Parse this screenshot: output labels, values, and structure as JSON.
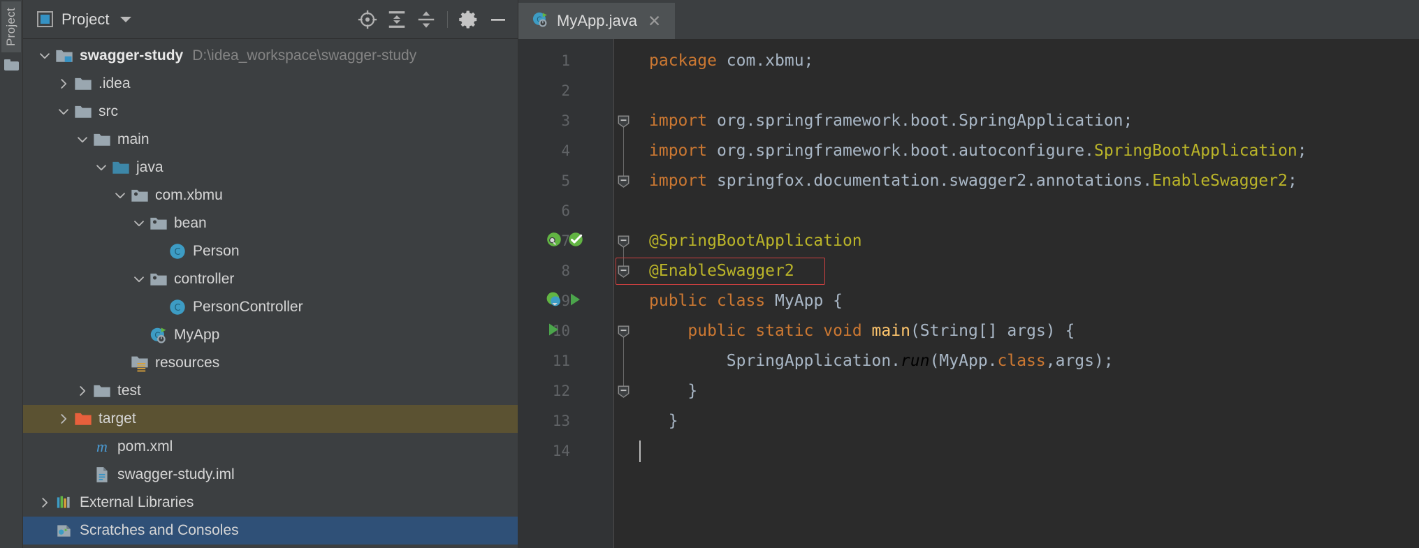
{
  "theme": {
    "panel_bg": "#3c3f41",
    "editor_bg": "#2b2b2b",
    "gutter_bg": "#313335",
    "tab_active_bg": "#4e5254",
    "tab_underline": "#4a88c7",
    "selection_active": "#2f5077",
    "selection_inactive": "#5b5232",
    "accent_blue": "#3592c4",
    "annotation_yellow": "#bbb529",
    "keyword_orange": "#cc7832",
    "text_default": "#a9b7c6",
    "highlight_box_red": "#cc4040",
    "method_yellow": "#ffc66d"
  },
  "toolstrip": {
    "vertical_tab_label": "Project",
    "icons": [
      "folder-icon"
    ]
  },
  "project_panel": {
    "header": {
      "icon": "project-view-icon",
      "title": "Project",
      "dropdown_icon": "chevron-down-icon",
      "tools": [
        {
          "name": "locate-in-tree-icon",
          "label": "Select Opened File"
        },
        {
          "name": "expand-all-icon",
          "label": "Expand All"
        },
        {
          "name": "collapse-all-icon",
          "label": "Collapse All"
        },
        {
          "name": "gear-icon",
          "label": "Settings"
        },
        {
          "name": "minimize-icon",
          "label": "Hide"
        }
      ]
    },
    "tree": [
      {
        "label": "swagger-study",
        "sublabel": "D:\\idea_workspace\\swagger-study",
        "depth": 0,
        "twisty": "expanded",
        "icon": "module-folder-icon",
        "bold": true,
        "selected": "none"
      },
      {
        "label": ".idea",
        "sublabel": "",
        "depth": 1,
        "twisty": "collapsed",
        "icon": "folder-icon",
        "bold": false,
        "selected": "none"
      },
      {
        "label": "src",
        "sublabel": "",
        "depth": 1,
        "twisty": "expanded",
        "icon": "folder-icon",
        "bold": false,
        "selected": "none"
      },
      {
        "label": "main",
        "sublabel": "",
        "depth": 2,
        "twisty": "expanded",
        "icon": "folder-icon",
        "bold": false,
        "selected": "none"
      },
      {
        "label": "java",
        "sublabel": "",
        "depth": 3,
        "twisty": "expanded",
        "icon": "source-root-folder-icon",
        "bold": false,
        "selected": "none"
      },
      {
        "label": "com.xbmu",
        "sublabel": "",
        "depth": 4,
        "twisty": "expanded",
        "icon": "package-icon",
        "bold": false,
        "selected": "none"
      },
      {
        "label": "bean",
        "sublabel": "",
        "depth": 5,
        "twisty": "expanded",
        "icon": "package-icon",
        "bold": false,
        "selected": "none"
      },
      {
        "label": "Person",
        "sublabel": "",
        "depth": 6,
        "twisty": "none",
        "icon": "java-class-icon",
        "bold": false,
        "selected": "none"
      },
      {
        "label": "controller",
        "sublabel": "",
        "depth": 5,
        "twisty": "expanded",
        "icon": "package-icon",
        "bold": false,
        "selected": "none"
      },
      {
        "label": "PersonController",
        "sublabel": "",
        "depth": 6,
        "twisty": "none",
        "icon": "java-class-icon",
        "bold": false,
        "selected": "none"
      },
      {
        "label": "MyApp",
        "sublabel": "",
        "depth": 5,
        "twisty": "none",
        "icon": "spring-boot-class-icon",
        "bold": false,
        "selected": "none"
      },
      {
        "label": "resources",
        "sublabel": "",
        "depth": 4,
        "twisty": "none",
        "icon": "resources-root-folder-icon",
        "bold": false,
        "selected": "none"
      },
      {
        "label": "test",
        "sublabel": "",
        "depth": 2,
        "twisty": "collapsed",
        "icon": "folder-icon",
        "bold": false,
        "selected": "none"
      },
      {
        "label": "target",
        "sublabel": "",
        "depth": 1,
        "twisty": "collapsed",
        "icon": "excluded-folder-icon",
        "bold": false,
        "selected": "inactive"
      },
      {
        "label": "pom.xml",
        "sublabel": "",
        "depth": 2,
        "twisty": "none",
        "icon": "maven-pom-icon",
        "bold": false,
        "selected": "none"
      },
      {
        "label": "swagger-study.iml",
        "sublabel": "",
        "depth": 2,
        "twisty": "none",
        "icon": "iml-module-file-icon",
        "bold": false,
        "selected": "none"
      },
      {
        "label": "External Libraries",
        "sublabel": "",
        "depth": 0,
        "twisty": "collapsed",
        "icon": "external-libraries-icon",
        "bold": false,
        "selected": "none"
      },
      {
        "label": "Scratches and Consoles",
        "sublabel": "",
        "depth": 0,
        "twisty": "none",
        "icon": "scratches-icon",
        "bold": false,
        "selected": "active"
      }
    ]
  },
  "editor": {
    "tab": {
      "title": "MyApp.java",
      "icon": "spring-boot-class-icon",
      "close_icon": "close-icon",
      "active": true
    },
    "line_numbers": [
      "1",
      "2",
      "3",
      "4",
      "5",
      "6",
      "7",
      "8",
      "9",
      "10",
      "11",
      "12",
      "13",
      "14"
    ],
    "gutter_marks": {
      "7": [
        "spring-bean-search-icon",
        "spring-bean-check-icon"
      ],
      "9": [
        "spring-boot-run-icon",
        "run-triangle-icon"
      ],
      "10": [
        "run-triangle-icon"
      ]
    },
    "fold_markers": {
      "3": "minus",
      "5": "minus",
      "7": "minus",
      "8": "minus",
      "10": "minus",
      "12": "minus"
    },
    "highlight_box": {
      "line": 8,
      "text": "@EnableSwagger2",
      "color": "#cc4040"
    },
    "caret": {
      "line": 14,
      "column": 1
    },
    "lines": [
      {
        "n": 1,
        "tokens": [
          {
            "t": "package",
            "c": "kw"
          },
          {
            "t": " com.xbmu;",
            "c": "plain"
          }
        ]
      },
      {
        "n": 2,
        "tokens": []
      },
      {
        "n": 3,
        "tokens": [
          {
            "t": "import",
            "c": "kw"
          },
          {
            "t": " org.springframework.boot.SpringApplication;",
            "c": "plain"
          }
        ]
      },
      {
        "n": 4,
        "tokens": [
          {
            "t": "import",
            "c": "kw"
          },
          {
            "t": " org.springframework.boot.autoconfigure.",
            "c": "plain"
          },
          {
            "t": "SpringBootApplication",
            "c": "ann"
          },
          {
            "t": ";",
            "c": "plain"
          }
        ]
      },
      {
        "n": 5,
        "tokens": [
          {
            "t": "import",
            "c": "kw"
          },
          {
            "t": " springfox.documentation.swagger2.annotations.",
            "c": "plain"
          },
          {
            "t": "EnableSwagger2",
            "c": "ann"
          },
          {
            "t": ";",
            "c": "plain"
          }
        ]
      },
      {
        "n": 6,
        "tokens": []
      },
      {
        "n": 7,
        "tokens": [
          {
            "t": "@SpringBootApplication",
            "c": "ann"
          }
        ]
      },
      {
        "n": 8,
        "tokens": [
          {
            "t": "@EnableSwagger2",
            "c": "ann"
          }
        ]
      },
      {
        "n": 9,
        "tokens": [
          {
            "t": "public",
            "c": "kw"
          },
          {
            "t": " ",
            "c": "plain"
          },
          {
            "t": "class",
            "c": "kw"
          },
          {
            "t": " MyApp {",
            "c": "plain"
          }
        ]
      },
      {
        "n": 10,
        "tokens": [
          {
            "t": "    ",
            "c": "plain"
          },
          {
            "t": "public",
            "c": "kw"
          },
          {
            "t": " ",
            "c": "plain"
          },
          {
            "t": "static",
            "c": "kw"
          },
          {
            "t": " ",
            "c": "plain"
          },
          {
            "t": "void",
            "c": "kw"
          },
          {
            "t": " ",
            "c": "plain"
          },
          {
            "t": "main",
            "c": "hl"
          },
          {
            "t": "(String[] args) {",
            "c": "plain"
          }
        ]
      },
      {
        "n": 11,
        "tokens": [
          {
            "t": "        SpringApplication.",
            "c": "plain"
          },
          {
            "t": "run",
            "c": "ital"
          },
          {
            "t": "(MyApp.",
            "c": "plain"
          },
          {
            "t": "class",
            "c": "kw"
          },
          {
            "t": ",args);",
            "c": "plain"
          }
        ]
      },
      {
        "n": 12,
        "tokens": [
          {
            "t": "    }",
            "c": "plain"
          }
        ]
      },
      {
        "n": 13,
        "tokens": [
          {
            "t": "  }",
            "c": "plain"
          }
        ]
      },
      {
        "n": 14,
        "tokens": []
      }
    ]
  }
}
